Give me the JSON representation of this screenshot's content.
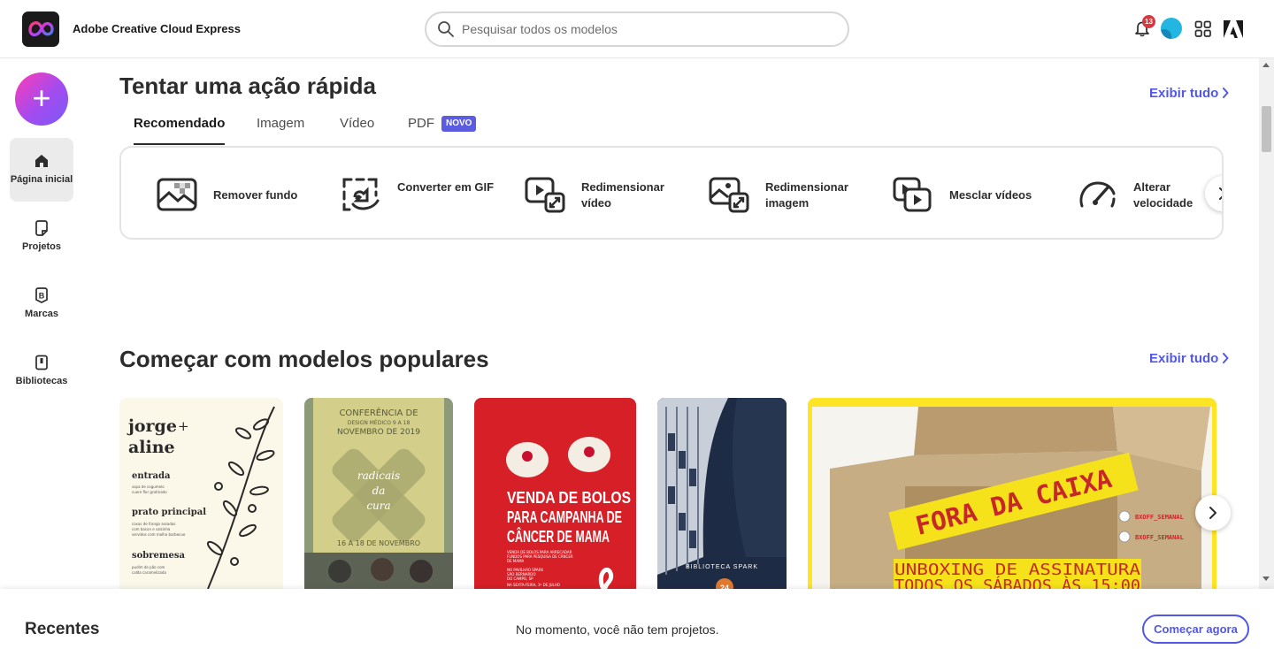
{
  "app": {
    "title": "Adobe Creative Cloud Express"
  },
  "search": {
    "placeholder": "Pesquisar todos os modelos"
  },
  "header": {
    "notification_count": "13"
  },
  "sidebar": {
    "items": [
      {
        "label": "Página inicial",
        "icon": "home-icon",
        "active": true
      },
      {
        "label": "Projetos",
        "icon": "projects-icon"
      },
      {
        "label": "Marcas",
        "icon": "brand-icon"
      },
      {
        "label": "Bibliotecas",
        "icon": "library-icon"
      }
    ]
  },
  "quick_actions": {
    "title": "Tentar uma ação rápida",
    "see_all": "Exibir tudo",
    "tabs": [
      "Recomendado",
      "Imagem",
      "Vídeo",
      "PDF"
    ],
    "new_badge": "NOVO",
    "items": [
      {
        "label": "Remover fundo",
        "icon": "remove-background-icon"
      },
      {
        "label": "Converter em GIF",
        "icon": "convert-gif-icon"
      },
      {
        "label": "Redimensionar vídeo",
        "icon": "resize-video-icon"
      },
      {
        "label": "Redimensionar imagem",
        "icon": "resize-image-icon"
      },
      {
        "label": "Mesclar vídeos",
        "icon": "merge-videos-icon"
      },
      {
        "label": "Alterar velocidade",
        "icon": "change-speed-icon"
      }
    ]
  },
  "templates": {
    "title": "Começar com modelos populares",
    "see_all": "Exibir tudo",
    "cards": {
      "menu": {
        "name1": "jorge",
        "plus": "+",
        "name2": "aline",
        "s1": "entrada",
        "s1_d1": "sopa de cogumelo",
        "s1_d2": "cuore flor gratinado",
        "s2": "prato principal",
        "s2_d1": "coxas de frango assadas",
        "s2_d2": "com bacon e salsinha",
        "s2_d3": "servidos com molho barbecue",
        "s3": "sobremesa",
        "s3_d1": "pudim de pão com",
        "s3_d2": "calda caramelizada"
      },
      "conference": {
        "l1": "CONFERÊNCIA DE",
        "l2": "DESIGN MÉDICO 9 A 18",
        "l3": "NOVEMBRO DE 2019",
        "script1": "radicais",
        "script2": "da",
        "script3": "cura",
        "dates": "16 A 18 DE NOVEMBRO"
      },
      "bake_sale": {
        "l1": "VENDA DE BOLOS",
        "l2": "PARA CAMPANHA DE",
        "l3": "CÂNCER DE MAMA",
        "s1": "VENDA DE BOLOS PARA ARRECADAR",
        "s2": "FUNDOS PARA PESQUISA DE CÂNCER",
        "s3": "DE MAMA",
        "s4": "NO PAVILHÃO SPARK",
        "s5": "SÃO BERNARDO",
        "s6": "DO CAMPO, SP",
        "s7": "NA SEXTA-FEIRA, 1º DE JULHO"
      },
      "library": {
        "label": "BIBLIOTECA SPARK",
        "date": "24"
      },
      "unboxing": {
        "banner": "FORA DA CAIXA",
        "l1": "UNBOXING DE ASSINATURA",
        "l2": "TODOS OS SÁBADOS ÀS 15:00",
        "social1": "BXOFF_SEMANAL",
        "social2": "BXOFF_SEMANAL"
      }
    }
  },
  "recent": {
    "title": "Recentes",
    "empty": "No momento, você não tem projetos.",
    "cta": "Começar agora"
  },
  "colors": {
    "accent": "#5258e4",
    "badge": "#d7373f",
    "new_badge": "#5c5ce0"
  }
}
